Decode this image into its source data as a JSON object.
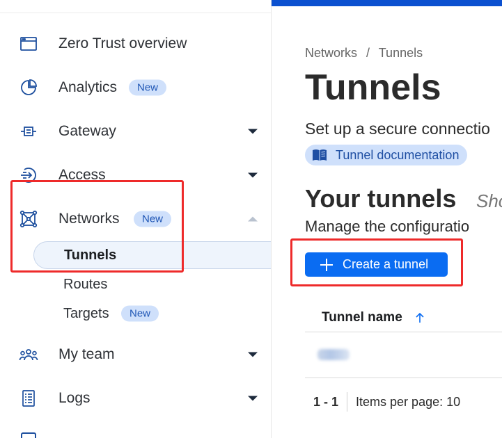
{
  "sidebar": {
    "items": [
      {
        "label": "Zero Trust overview",
        "icon": "browser-window-icon"
      },
      {
        "label": "Analytics",
        "badge": "New",
        "icon": "pie-chart-icon"
      },
      {
        "label": "Gateway",
        "icon": "gateway-icon"
      },
      {
        "label": "Access",
        "icon": "access-arrow-icon"
      },
      {
        "label": "Networks",
        "badge": "New",
        "icon": "network-mesh-icon"
      },
      {
        "label": "My team",
        "icon": "team-people-icon"
      },
      {
        "label": "Logs",
        "icon": "logs-document-icon"
      }
    ],
    "networks_sub": {
      "tunnels": "Tunnels",
      "routes": "Routes",
      "targets": "Targets",
      "targets_badge": "New"
    }
  },
  "main": {
    "breadcrumb": {
      "parent": "Networks",
      "separator": "/",
      "current": "Tunnels"
    },
    "title": "Tunnels",
    "subtitle": "Set up a secure connectio",
    "doc_link": "Tunnel documentation",
    "section_title": "Your tunnels",
    "section_aside": "Sho",
    "section_desc": "Manage the configuratio",
    "create_button": "Create a tunnel",
    "table": {
      "column_tunnel_name": "Tunnel name"
    },
    "pagination": {
      "range": "1 - 1",
      "items_per_page": "Items per page: 10"
    }
  },
  "colors": {
    "accent": "#0a6cf2",
    "top_bar": "#0c51d0",
    "badge_bg": "#cfe0fb",
    "highlight": "#ee2a2a"
  }
}
